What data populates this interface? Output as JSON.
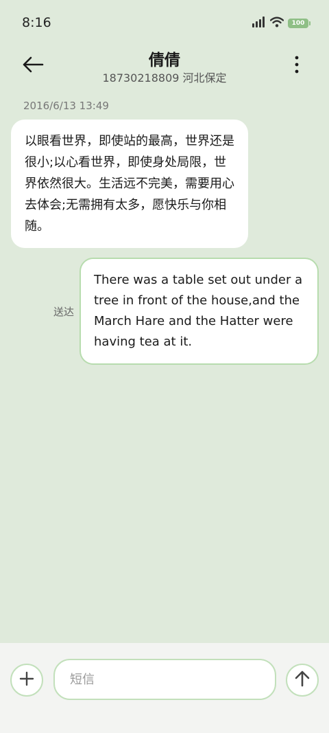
{
  "status_bar": {
    "time": "8:16",
    "battery": "100",
    "icons": [
      "signal-icon",
      "wifi-icon",
      "battery-icon"
    ]
  },
  "header": {
    "contact_name": "倩倩",
    "contact_subtitle": "18730218809 河北保定",
    "icons": [
      "back-arrow-icon",
      "more-vertical-icon"
    ]
  },
  "conversation": {
    "timestamp": "2016/6/13 13:49",
    "received_message": "以眼看世界，即使站的最高，世界还是很小;以心看世界，即使身处局限，世界依然很大。生活远不完美，需要用心去体会;无需拥有太多，愿快乐与你相随。",
    "sent_message": "There was a table set out under a tree in front of the house,and the March Hare and the Hatter were having tea at it.",
    "sent_status": "送达"
  },
  "composer": {
    "placeholder": "短信",
    "value": "",
    "icons": [
      "plus-icon",
      "send-arrow-icon"
    ]
  },
  "colors": {
    "background": "#dfeadb",
    "bubble": "#ffffff",
    "accent_border": "#b7dcae",
    "bottom_bar": "#f3f4f2"
  }
}
